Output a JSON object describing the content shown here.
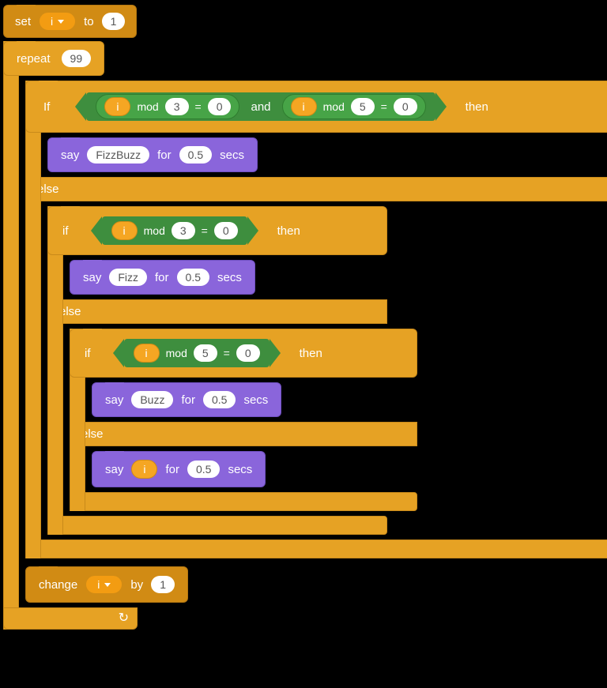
{
  "set_block": {
    "set_kw": "set",
    "var": "i",
    "to_kw": "to",
    "val": "1"
  },
  "repeat_block": {
    "repeat_kw": "repeat",
    "times": "99"
  },
  "if1": {
    "if_kw": "If",
    "then_kw": "then",
    "else_kw": "else",
    "var_a": "i",
    "mod_kw_a": "mod",
    "mod_a": "3",
    "eq_a": "=",
    "zero_a": "0",
    "and_kw": "and",
    "var_b": "i",
    "mod_kw_b": "mod",
    "mod_b": "5",
    "eq_b": "=",
    "zero_b": "0"
  },
  "say1": {
    "say_kw": "say",
    "msg": "FizzBuzz",
    "for_kw": "for",
    "dur": "0.5",
    "secs_kw": "secs"
  },
  "if2": {
    "if_kw": "if",
    "then_kw": "then",
    "else_kw": "else",
    "var": "i",
    "mod_kw": "mod",
    "mod": "3",
    "eq": "=",
    "zero": "0"
  },
  "say2": {
    "say_kw": "say",
    "msg": "Fizz",
    "for_kw": "for",
    "dur": "0.5",
    "secs_kw": "secs"
  },
  "if3": {
    "if_kw": "if",
    "then_kw": "then",
    "else_kw": "else",
    "var": "i",
    "mod_kw": "mod",
    "mod": "5",
    "eq": "=",
    "zero": "0"
  },
  "say3": {
    "say_kw": "say",
    "msg": "Buzz",
    "for_kw": "for",
    "dur": "0.5",
    "secs_kw": "secs"
  },
  "say4": {
    "say_kw": "say",
    "var": "i",
    "for_kw": "for",
    "dur": "0.5",
    "secs_kw": "secs"
  },
  "change_block": {
    "change_kw": "change",
    "var": "i",
    "by_kw": "by",
    "val": "1"
  }
}
